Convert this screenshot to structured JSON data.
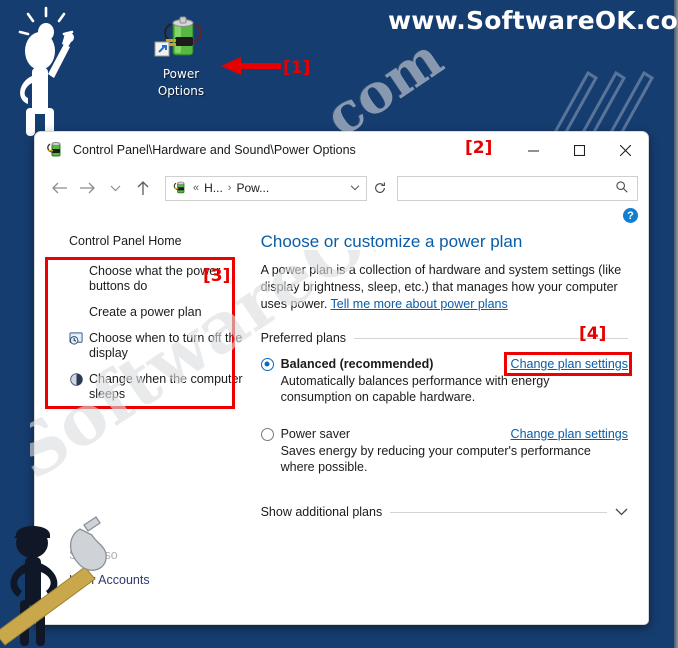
{
  "branding": {
    "site": "www.SoftwareOK.com :-)",
    "watermark": "SoftwareOK",
    "watermark_small": "com"
  },
  "annotations": {
    "tag1": "[1]",
    "tag2": "[2]",
    "tag3": "[3]",
    "tag4": "[4]"
  },
  "desktop": {
    "icon": {
      "name": "power-options-shortcut",
      "label_line1": "Power",
      "label_line2": "Options"
    }
  },
  "window": {
    "title": "Control Panel\\Hardware and Sound\\Power Options",
    "buttons": {
      "minimize": "─",
      "maximize": "☐",
      "close": "✕"
    },
    "nav": {
      "back": "←",
      "forward": "→",
      "recent": "⌄",
      "up": "↑",
      "refresh": "⟳"
    },
    "address": {
      "prefix": "«",
      "crumb1": "H...",
      "separator": "›",
      "crumb2": "Pow...",
      "dropdown": "⌄"
    },
    "search": {
      "value": "",
      "placeholder": "",
      "icon": "⌕"
    },
    "help": "?"
  },
  "sidebar": {
    "home": "Control Panel Home",
    "items": [
      {
        "label": "Choose what the power buttons do",
        "icon": "none"
      },
      {
        "label": "Create a power plan",
        "icon": "none"
      },
      {
        "label": "Choose when to turn off the display",
        "icon": "display-clock-icon"
      },
      {
        "label": "Change when the computer sleeps",
        "icon": "sleep-moon-icon"
      }
    ],
    "see_also_label": "See also",
    "see_also_link": "User Accounts"
  },
  "main": {
    "heading": "Choose or customize a power plan",
    "intro_text": "A power plan is a collection of hardware and system settings (like display brightness, sleep, etc.) that manages how your computer uses power. ",
    "intro_link": "Tell me more about power plans",
    "preferred_plans_label": "Preferred plans",
    "plans": [
      {
        "name": "Balanced (recommended)",
        "selected": true,
        "description": "Automatically balances performance with energy consumption on capable hardware.",
        "change_link": "Change plan settings"
      },
      {
        "name": "Power saver",
        "selected": false,
        "description": "Saves energy by reducing your computer's performance where possible.",
        "change_link": "Change plan settings"
      }
    ],
    "show_additional": "Show additional plans",
    "show_additional_chevron": "⌄"
  },
  "colors": {
    "desktop_bg": "#163d70",
    "accent_link": "#0a5ca8",
    "annotation_red": "#ee0000",
    "radio_blue": "#0a67c2",
    "help_blue": "#0f7fd4"
  }
}
